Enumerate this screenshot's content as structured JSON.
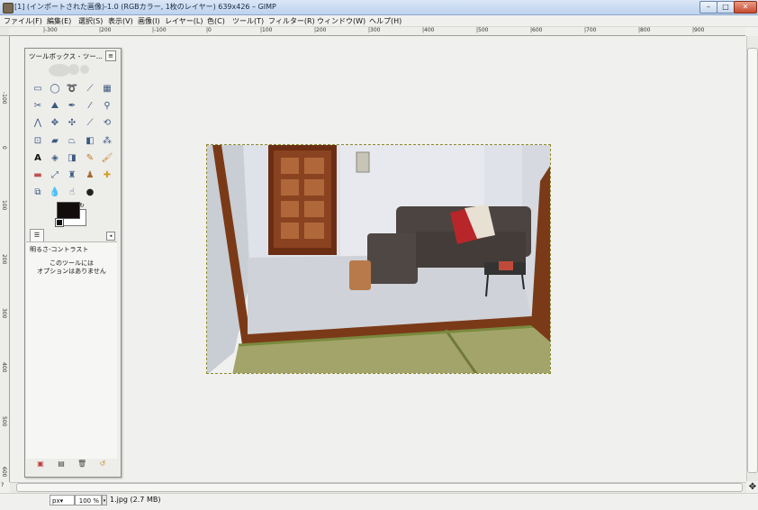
{
  "window": {
    "title": "[1] (インポートされた画像)-1.0 (RGBカラー, 1枚のレイヤー) 639x426 – GIMP",
    "minimize": "–",
    "maximize": "□",
    "close": "✕"
  },
  "menu": {
    "items": [
      "ファイル(F)",
      "編集(E)",
      "選択(S)",
      "表示(V)",
      "画像(I)",
      "レイヤー(L)",
      "色(C)",
      "ツール(T)",
      "フィルター(R)",
      "ウィンドウ(W)",
      "ヘルプ(H)"
    ]
  },
  "ruler": {
    "h_labels": [
      "|-300",
      "|200",
      "|-100",
      "|0",
      "|100",
      "|200",
      "|300",
      "|400",
      "|500",
      "|600",
      "|700",
      "|800",
      "|900"
    ],
    "v_labels": [
      "-100",
      "0",
      "100",
      "200",
      "300",
      "400",
      "500",
      "600"
    ]
  },
  "toolbox": {
    "title": "ツールボックス - ツー...",
    "menu_icon": "≡",
    "tab_icon": "☰",
    "tab_menu_icon": "◂",
    "options_header": "明るさ-コントラスト",
    "options_msg1": "このツールには",
    "options_msg2": "オプションはありません",
    "icons": [
      "rect-select",
      "ellipse-select",
      "free-select",
      "fuzzy-select",
      "color-select",
      "scissors-select",
      "foreground-select",
      "paths",
      "color-picker",
      "zoom",
      "measure",
      "move",
      "align",
      "crop",
      "rotate",
      "scale",
      "shear",
      "perspective",
      "flip",
      "cage",
      "text",
      "bucket-fill",
      "blend",
      "pencil",
      "paintbrush",
      "eraser",
      "airbrush",
      "ink",
      "clone",
      "heal",
      "perspective-clone",
      "blur",
      "smudge",
      "dodge-burn"
    ],
    "bottom_icons": [
      "save-preset-icon",
      "restore-preset-icon",
      "delete-preset-icon",
      "reset-icon"
    ],
    "colors": {
      "foreground": "#120c0c",
      "background": "#ffffff"
    }
  },
  "status": {
    "unit": "px▾",
    "zoom": "100 %",
    "zoom_drop": "▾",
    "info": "1.jpg (2.7 MB)"
  },
  "scroll": {
    "nav": "✥",
    "corner": "?"
  }
}
